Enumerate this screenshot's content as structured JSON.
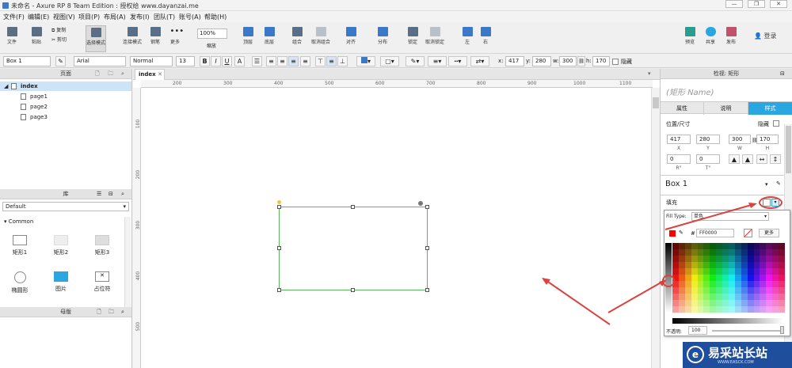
{
  "window": {
    "title": "未命名 - Axure RP 8 Team Edition : 授权给 www.dayanzai.me"
  },
  "menu": [
    "文件(F)",
    "编辑(E)",
    "视图(V)",
    "项目(P)",
    "布局(A)",
    "发布(I)",
    "团队(T)",
    "账号(A)",
    "帮助(H)"
  ],
  "toolbar": {
    "file": "文件",
    "paste": "粘贴",
    "copy": "复制",
    "cut": "剪切",
    "select_mode": "选择模式",
    "connect_mode": "连接模式",
    "pen": "钢笔",
    "more": "更多",
    "zoom": "100%",
    "zoom_label": "缩放",
    "top": "顶层",
    "bottom": "底层",
    "group": "组合",
    "ungroup": "取消组合",
    "align": "对齐",
    "distribute": "分布",
    "lock": "锁定",
    "unlock": "取消锁定",
    "left": "左",
    "right": "右",
    "preview": "预览",
    "share": "共享",
    "publish": "发布",
    "login": "登录"
  },
  "format": {
    "widget": "Box 1",
    "font": "Arial",
    "style": "Normal",
    "size": "13",
    "x_label": "x:",
    "x": "417",
    "y_label": "y:",
    "y": "280",
    "w_label": "w:",
    "w": "300",
    "h_label": "h:",
    "h": "170",
    "hide": "隐藏"
  },
  "pages": {
    "title": "页面",
    "items": [
      "index",
      "page1",
      "page2",
      "page3"
    ]
  },
  "library": {
    "title": "库",
    "selected": "Default",
    "group": "Common",
    "items": [
      "矩形1",
      "矩形2",
      "矩形3",
      "椭圆形",
      "图片",
      "占位符"
    ]
  },
  "masters": {
    "title": "母版"
  },
  "canvas": {
    "tab": "index",
    "hticks": [
      "200",
      "300",
      "400",
      "500",
      "600",
      "700",
      "800",
      "900",
      "1000",
      "1100"
    ],
    "vticks": [
      "100",
      "200",
      "300",
      "400",
      "500"
    ]
  },
  "inspector": {
    "title": "检视: 矩形",
    "name_placeholder": "(矩形 Name)",
    "tabs": [
      "属性",
      "说明",
      "样式"
    ],
    "pos_size": "位置/尺寸",
    "hidden": "隐藏",
    "x": "417",
    "y": "280",
    "w": "300",
    "h": "170",
    "x_l": "X",
    "y_l": "Y",
    "w_l": "W",
    "h_l": "H",
    "r": "0",
    "t": "0",
    "r_l": "R°",
    "t_l": "T°",
    "widget_name": "Box 1",
    "fill": "填充",
    "fill_type_label": "Fill Type:",
    "fill_type": "单色",
    "hex_label": "#",
    "hex": "FF0000",
    "more": "更多",
    "opacity_label": "不透明:",
    "opacity": "100"
  },
  "watermark": {
    "text": "易采站长站",
    "sub": "WWW.EASCK.COM"
  },
  "colors": {
    "selection": "#5cb85c",
    "accent": "#2aa7e0",
    "arrow": "#d9433e",
    "palette_red": "#ff0000"
  }
}
